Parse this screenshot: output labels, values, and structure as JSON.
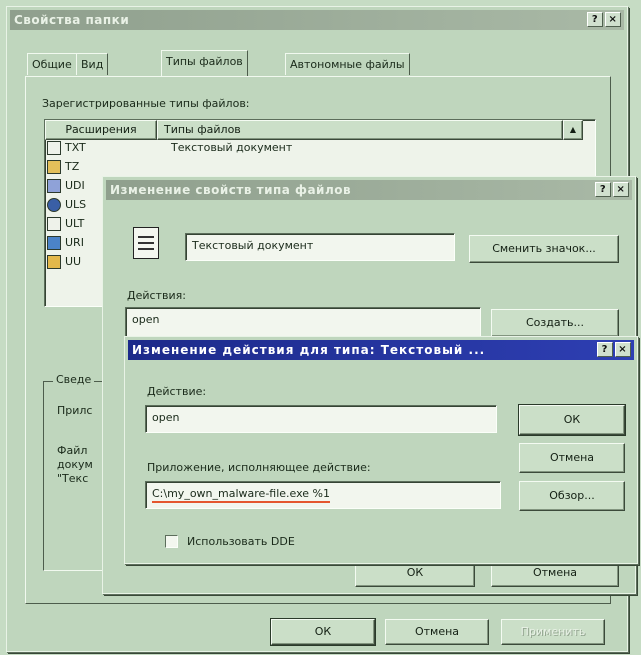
{
  "main_dialog": {
    "title": "Свойства папки",
    "help_btn": "?",
    "close_btn": "×",
    "tabs": [
      "Общие",
      "Вид",
      "Типы файлов",
      "Автономные файлы"
    ],
    "registered_label": "Зарегистрированные типы файлов:",
    "columns": [
      "Расширения",
      "Типы файлов"
    ],
    "rows": [
      {
        "ext": "TXT",
        "type": "Текстовый документ"
      },
      {
        "ext": "TZ",
        "type": ""
      },
      {
        "ext": "UDI",
        "type": ""
      },
      {
        "ext": "ULS",
        "type": ""
      },
      {
        "ext": "ULT",
        "type": ""
      },
      {
        "ext": "URI",
        "type": ""
      },
      {
        "ext": "UU",
        "type": ""
      }
    ],
    "details_label": "Сведе",
    "app_label": "Прилс",
    "desc_lines": [
      "Файл",
      "докум",
      "\"Текс"
    ],
    "ok": "ОК",
    "cancel": "Отмена",
    "apply": "Применить"
  },
  "edit_type_dialog": {
    "title": "Изменение свойств типа файлов",
    "help_btn": "?",
    "close_btn": "×",
    "type_name": "Текстовый документ",
    "change_icon": "Сменить значок...",
    "actions_label": "Действия:",
    "action_item": "open",
    "create": "Создать...",
    "ok": "ОК",
    "cancel": "Отмена"
  },
  "edit_action_dialog": {
    "title": "Изменение действия для типа: Текстовый ...",
    "help_btn": "?",
    "close_btn": "×",
    "action_label": "Действие:",
    "action_value": "open",
    "app_label": "Приложение, исполняющее действие:",
    "app_value": "C:\\my_own_malware-file.exe %1",
    "ok": "ОК",
    "cancel": "Отмена",
    "browse": "Обзор...",
    "use_dde": "Использовать DDE"
  }
}
